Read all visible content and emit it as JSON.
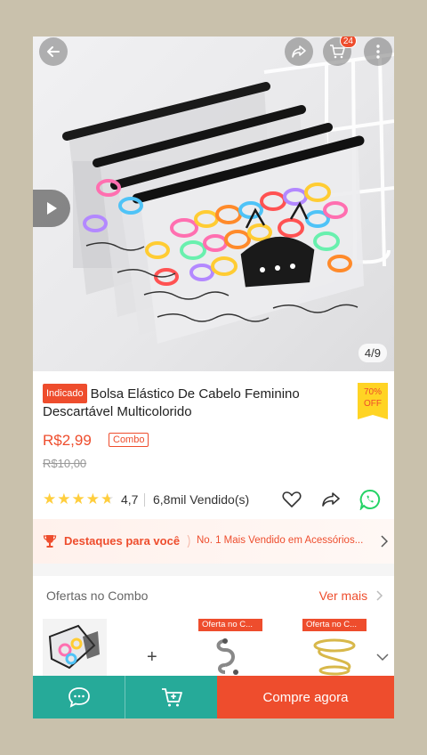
{
  "hero": {
    "counter": "4/9",
    "cart_count": "24"
  },
  "product": {
    "tag": "Indicado",
    "title": "Bolsa Elástico De Cabelo Feminino Descartável Multicolorido",
    "discount_pct": "70%",
    "discount_off": "OFF",
    "price": "R$2,99",
    "combo_label": "Combo",
    "old_price": "R$10,00",
    "rating_stars": 4.7,
    "rating": "4,7",
    "sold": "6,8mil Vendido(s)"
  },
  "highlights": {
    "title": "Destaques para você",
    "description": "No. 1 Mais Vendido em Acessórios..."
  },
  "combo_section": {
    "heading": "Ofertas no Combo",
    "see_more": "Ver mais",
    "plus": "+",
    "offer_tag_1": "Oferta no C...",
    "offer_tag_2": "Oferta no C..."
  },
  "bottom_bar": {
    "buy_now": "Compre agora"
  },
  "colors": {
    "brand": "#ee4d2d",
    "teal": "#26aa99",
    "star": "#ffce3d",
    "badge": "#ffd424"
  }
}
